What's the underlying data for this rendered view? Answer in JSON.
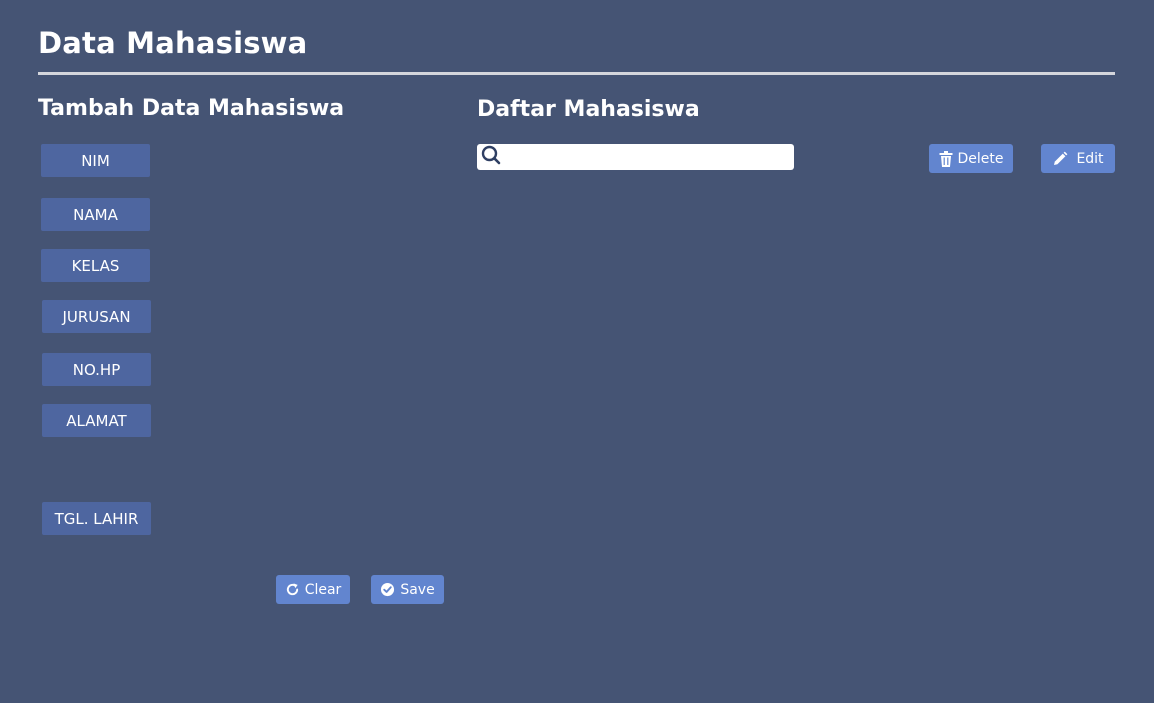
{
  "header": {
    "title": "Data Mahasiswa"
  },
  "form": {
    "title": "Tambah Data Mahasiswa",
    "fields": {
      "nim": "NIM",
      "nama": "NAMA",
      "kelas": "KELAS",
      "jurusan": "JURUSAN",
      "nohp": "NO.HP",
      "alamat": "ALAMAT",
      "tgl_lahir": "TGL. LAHIR"
    },
    "clear_label": "Clear",
    "save_label": "Save"
  },
  "list": {
    "title": "Daftar Mahasiswa",
    "search": {
      "value": "",
      "placeholder": ""
    },
    "delete_label": "Delete",
    "edit_label": "Edit"
  },
  "icons": {
    "search": "search-icon",
    "delete": "trash-icon",
    "edit": "pencil-icon",
    "clear": "refresh-icon",
    "save": "check-circle-icon"
  },
  "colors": {
    "background": "#455474",
    "label_bg": "#4e66a0",
    "button_bg": "#6285cf",
    "rule": "#d4d6dc"
  }
}
